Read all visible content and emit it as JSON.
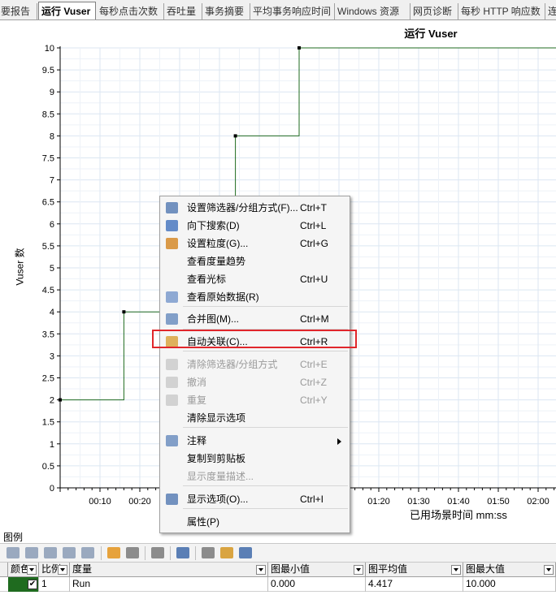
{
  "tabs": [
    "要报告",
    "运行 Vuser",
    "每秒点击次数",
    "吞吐量",
    "事务摘要",
    "平均事务响应时间",
    "Windows 资源",
    "网页诊断",
    "每秒 HTTP 响应数",
    "连"
  ],
  "active_tab_index": 1,
  "chart": {
    "title": "运行 Vuser",
    "ylabel": "Vuser 数",
    "xlabel": "已用场景时间 mm:ss"
  },
  "chart_data": {
    "type": "line",
    "title": "运行 Vuser",
    "xlabel": "已用场景时间 mm:ss",
    "ylabel": "Vuser 数",
    "ylim": [
      0,
      10
    ],
    "yticks": [
      "0",
      "0.5",
      "1",
      "1.5",
      "2",
      "2.5",
      "3",
      "3.5",
      "4",
      "4.5",
      "5",
      "5.5",
      "6",
      "6.5",
      "7",
      "7.5",
      "8",
      "8.5",
      "9",
      "9.5",
      "10"
    ],
    "xticks": [
      "00:10",
      "00:20",
      "01:20",
      "01:30",
      "01:40",
      "01:50",
      "02:00"
    ],
    "series": [
      {
        "name": "Run",
        "color": "#1f6b1f",
        "step": true,
        "points": [
          [
            0,
            2
          ],
          [
            16,
            2
          ],
          [
            16,
            4
          ],
          [
            44,
            4
          ],
          [
            44,
            8
          ],
          [
            60,
            8
          ],
          [
            60,
            10
          ],
          [
            126,
            10
          ]
        ]
      }
    ],
    "grid": true,
    "line_color": "#1f6b1f"
  },
  "context_menu": {
    "items": [
      {
        "label": "设置筛选器/分组方式(F)...",
        "shortcut": "Ctrl+T",
        "icon": "filter-icon",
        "disabled": false
      },
      {
        "label": "向下搜索(D)",
        "shortcut": "Ctrl+L",
        "icon": "drill-down-icon",
        "disabled": false
      },
      {
        "label": "设置粒度(G)...",
        "shortcut": "Ctrl+G",
        "icon": "granularity-icon",
        "disabled": false
      },
      {
        "label": "查看度量趋势",
        "shortcut": "",
        "icon": "",
        "disabled": false
      },
      {
        "label": "查看光标",
        "shortcut": "Ctrl+U",
        "icon": "",
        "disabled": false
      },
      {
        "label": "查看原始数据(R)",
        "shortcut": "",
        "icon": "raw-data-icon",
        "disabled": false
      },
      {
        "label": "合并图(M)...",
        "shortcut": "Ctrl+M",
        "icon": "merge-graph-icon",
        "disabled": false
      },
      {
        "label": "自动关联(C)...",
        "shortcut": "Ctrl+R",
        "icon": "auto-correlate-icon",
        "disabled": false
      },
      {
        "label": "清除筛选器/分组方式",
        "shortcut": "Ctrl+E",
        "icon": "clear-filter-icon",
        "disabled": true
      },
      {
        "label": "撤消",
        "shortcut": "Ctrl+Z",
        "icon": "undo-icon",
        "disabled": true
      },
      {
        "label": "重复",
        "shortcut": "Ctrl+Y",
        "icon": "redo-icon",
        "disabled": true
      },
      {
        "label": "清除显示选项",
        "shortcut": "",
        "icon": "",
        "disabled": false
      },
      {
        "label": "注释",
        "shortcut": "",
        "icon": "comment-icon",
        "disabled": false,
        "submenu": true
      },
      {
        "label": "复制到剪贴板",
        "shortcut": "",
        "icon": "",
        "disabled": false
      },
      {
        "label": "显示度量描述...",
        "shortcut": "",
        "icon": "",
        "disabled": true
      },
      {
        "label": "显示选项(O)...",
        "shortcut": "Ctrl+I",
        "icon": "display-options-icon",
        "disabled": false
      },
      {
        "label": "属性(P)",
        "shortcut": "",
        "icon": "",
        "disabled": false
      }
    ]
  },
  "legend": {
    "title": "图例",
    "columns": [
      "颜色",
      "比例",
      "度量",
      "图最小值",
      "图平均值",
      "图最大值"
    ],
    "rows": [
      {
        "color": "#1f6b1f",
        "checked": "✔",
        "scale": "1",
        "measure": "Run",
        "min": "0.000",
        "avg": "4.417",
        "max": "10.000"
      }
    ]
  }
}
